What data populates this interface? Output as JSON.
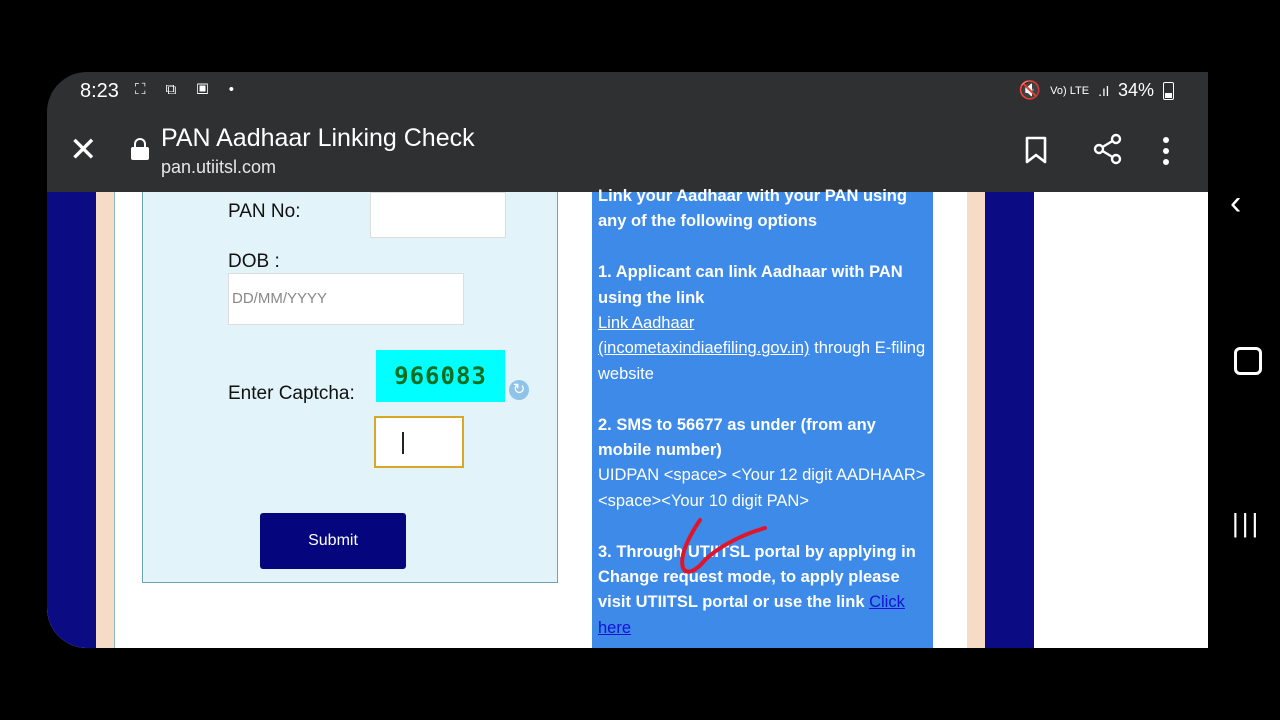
{
  "status_bar": {
    "time": "8:23",
    "left_icons": "⛶ ⧉ ▣ •",
    "signal_text": "Vo) LTE",
    "battery_percent": "34%"
  },
  "browser": {
    "title": "PAN Aadhaar Linking Check",
    "url": "pan.utiitsl.com"
  },
  "form": {
    "pan_label": "PAN No:",
    "pan_value": "",
    "dob_label": "DOB :",
    "dob_placeholder": "DD/MM/YYYY",
    "captcha_label": "Enter Captcha:",
    "captcha_code": "966083",
    "submit_label": "Submit"
  },
  "info": {
    "intro": "Link your Aadhaar with your PAN using any of the following options",
    "option1_heading": "1. Applicant can link Aadhaar with PAN using the link",
    "option1_link1": "Link Aadhaar",
    "option1_link2": "(incometaxindiaefiling.gov.in)",
    "option1_tail": " through E-filing website",
    "option2_heading": "2. SMS to 56677 as under (from any mobile number)",
    "option2_body": "UIDPAN <space> <Your 12 digit AADHAAR> <space><Your 10 digit PAN>",
    "option3_heading": "3. Through UTIITSL portal by applying in Change request mode, to apply please visit UTIITSL portal or use the link ",
    "option3_link": "Click here"
  }
}
